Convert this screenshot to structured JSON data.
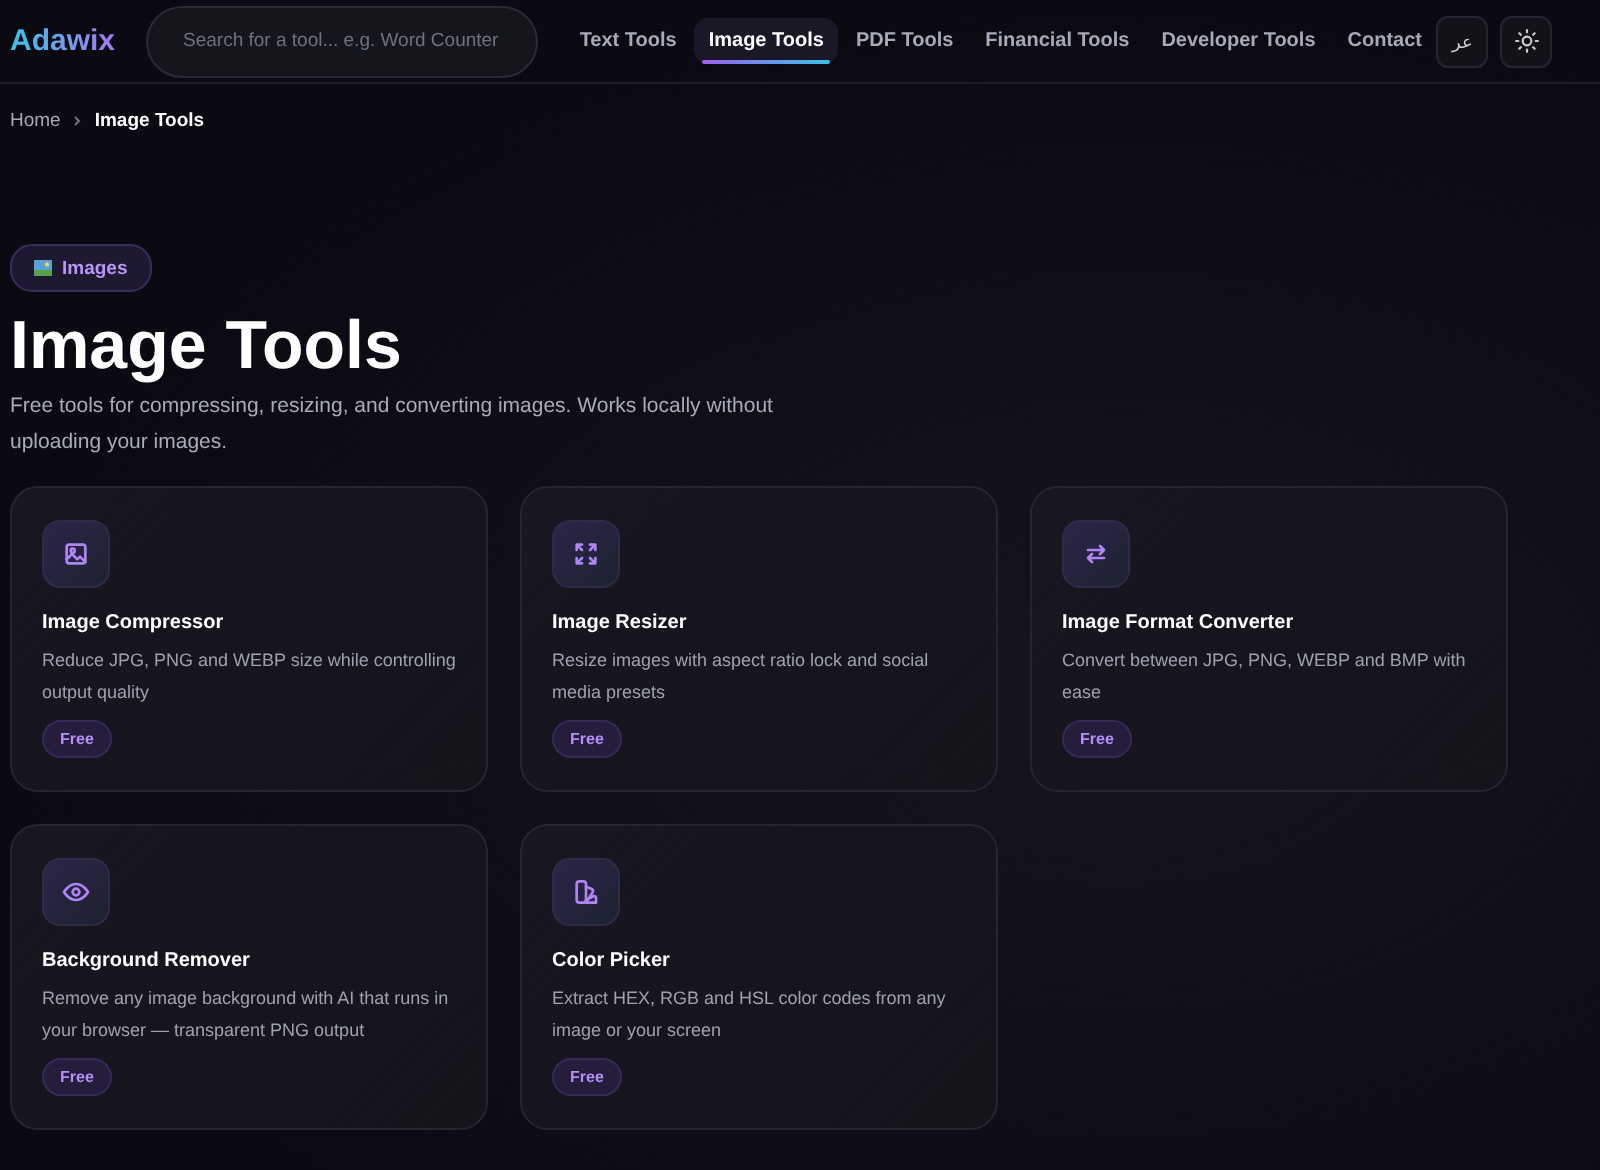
{
  "header": {
    "logo": "Adawix",
    "search": {
      "placeholder": "Search for a tool... e.g. Word Counter"
    },
    "nav": [
      {
        "label": "Text Tools",
        "selected": false
      },
      {
        "label": "Image Tools",
        "selected": true
      },
      {
        "label": "PDF Tools",
        "selected": false
      },
      {
        "label": "Financial Tools",
        "selected": false
      },
      {
        "label": "Developer Tools",
        "selected": false
      },
      {
        "label": "Contact",
        "selected": false
      }
    ],
    "language_button": "عر"
  },
  "breadcrumb": [
    {
      "label": "Home",
      "current": false
    },
    {
      "label": "Image Tools",
      "current": true
    }
  ],
  "category_badge": "Images",
  "title": "Image Tools",
  "subtitle": "Free tools for compressing, resizing, and converting images. Works locally without uploading your images.",
  "tools": [
    {
      "kind": "image",
      "name": "Image Compressor",
      "description": "Reduce JPG, PNG and WEBP size while controlling output quality",
      "tag": "Free"
    },
    {
      "kind": "resize",
      "name": "Image Resizer",
      "description": "Resize images with aspect ratio lock and social media presets",
      "tag": "Free"
    },
    {
      "kind": "convert",
      "name": "Image Format Converter",
      "description": "Convert between JPG, PNG, WEBP and BMP with ease",
      "tag": "Free"
    },
    {
      "kind": "eye",
      "name": "Background Remover",
      "description": "Remove any image background with AI that runs in your browser — transparent PNG output",
      "tag": "Free"
    },
    {
      "kind": "palette",
      "name": "Color Picker",
      "description": "Extract HEX, RGB and HSL color codes from any image or your screen",
      "tag": "Free"
    }
  ]
}
